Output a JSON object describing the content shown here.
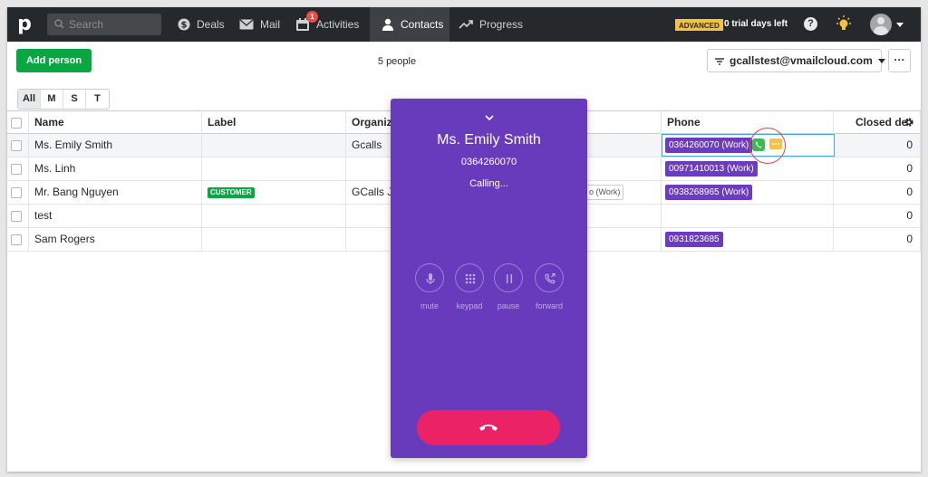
{
  "topbar": {
    "logo": "p",
    "search_placeholder": "Search",
    "nav": [
      {
        "label": "Deals",
        "icon": "dollar-circle-icon"
      },
      {
        "label": "Mail",
        "icon": "mail-icon"
      },
      {
        "label": "Activities",
        "icon": "calendar-icon",
        "badge": "1"
      },
      {
        "label": "Contacts",
        "icon": "person-icon",
        "active": true
      },
      {
        "label": "Progress",
        "icon": "trend-icon"
      }
    ],
    "plan_badge": "ADVANCED",
    "trial_text": "0 trial days left",
    "help_label": "?"
  },
  "toolbar": {
    "add_person": "Add person",
    "people_count": "5 people",
    "filter_label": "gcallstest@vmailcloud.com",
    "more_label": "···",
    "tabs": [
      "All",
      "M",
      "S",
      "T"
    ]
  },
  "table": {
    "headers": {
      "name": "Name",
      "label": "Label",
      "org": "Organiza",
      "phone": "Phone",
      "closed": "Closed de"
    },
    "rows": [
      {
        "name": "Ms. Emily Smith",
        "label": "",
        "org": "Gcalls",
        "phone": "0364260070 (Work)",
        "closed": "0"
      },
      {
        "name": "Ms. Linh",
        "label": "",
        "org": "",
        "phone": "00971410013 (Work)",
        "closed": "0"
      },
      {
        "name": "Mr. Bang Nguyen",
        "label": "CUSTOMER",
        "org": "GCalls JS",
        "phone": "0938268965 (Work)",
        "closed": "0"
      },
      {
        "name": "test",
        "label": "",
        "org": "",
        "phone": "",
        "closed": "0"
      },
      {
        "name": "Sam Rogers",
        "label": "",
        "org": "",
        "phone": "0931823685",
        "closed": "0"
      }
    ],
    "hidden_phone_fragment": "o (Work)"
  },
  "dialer": {
    "name": "Ms. Emily Smith",
    "number": "0364260070",
    "status": "Calling...",
    "controls": [
      {
        "label": "mute",
        "icon": "mic-icon"
      },
      {
        "label": "keypad",
        "icon": "keypad-icon"
      },
      {
        "label": "pause",
        "icon": "pause-icon"
      },
      {
        "label": "forward",
        "icon": "phone-forward-icon"
      }
    ]
  },
  "colors": {
    "topbar": "#26292c",
    "accent_green": "#08a742",
    "phone_tag": "#6c3cbf",
    "dialer_bg": "#683bbd",
    "hangup": "#ec2266"
  }
}
